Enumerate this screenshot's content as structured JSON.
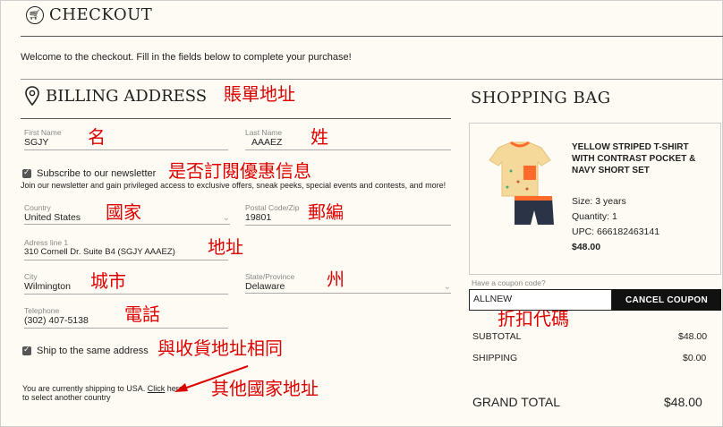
{
  "header": {
    "title": "CHECKOUT"
  },
  "welcome": "Welcome to the checkout. Fill in the fields below to complete your purchase!",
  "billing": {
    "title": "BILLING ADDRESS",
    "first_name": {
      "label": "First Name",
      "value": "SGJY"
    },
    "last_name": {
      "label": "Last Name",
      "value": "AAAEZ"
    },
    "newsletter": {
      "label": "Subscribe to our newsletter",
      "desc": "Join our newsletter and gain privileged access to exclusive offers, sneak peeks, special events and contests, and more!"
    },
    "country": {
      "label": "Country",
      "value": "United States"
    },
    "postal": {
      "label": "Postal Code/Zip",
      "value": "19801"
    },
    "address": {
      "label": "Adress line 1",
      "value": "310 Cornell Dr. Suite B4 (SGJY AAAEZ)"
    },
    "city": {
      "label": "City",
      "value": "Wilmington"
    },
    "state": {
      "label": "State/Province",
      "value": "Delaware"
    },
    "telephone": {
      "label": "Telephone",
      "value": "(302) 407-5138"
    },
    "ship_same": {
      "label": "Ship to the same address"
    },
    "shipping_note": {
      "before": "You are currently shipping to USA. ",
      "link": "Click",
      "after": " here",
      "line2": "to select another country"
    }
  },
  "annotations": {
    "billing": "賬單地址",
    "first_name": "名",
    "last_name": "姓",
    "newsletter": "是否訂閱優惠信息",
    "country": "國家",
    "postal": "郵編",
    "address": "地址",
    "city": "城市",
    "state": "州",
    "telephone": "電話",
    "coupon": "折扣代碼",
    "ship_same": "與收貨地址相同",
    "other_country": "其他國家地址"
  },
  "bag": {
    "title": "SHOPPING BAG",
    "product": {
      "name": "YELLOW STRIPED T-SHIRT WITH CONTRAST POCKET & NAVY SHORT SET",
      "size": "Size: 3 years",
      "quantity": "Quantity: 1",
      "upc": "UPC: 666182463141",
      "price": "$48.00"
    },
    "coupon": {
      "placeholder": "Have a coupon code?",
      "value": "ALLNEW",
      "button": "CANCEL COUPON"
    },
    "summary": {
      "subtotal_label": "SUBTOTAL",
      "subtotal": "$48.00",
      "shipping_label": "SHIPPING",
      "shipping": "$0.00",
      "grand_label": "GRAND TOTAL",
      "grand": "$48.00"
    }
  },
  "colors": {
    "annotation": "#dd0000",
    "background": "#fdfbf3",
    "button": "#111111"
  }
}
